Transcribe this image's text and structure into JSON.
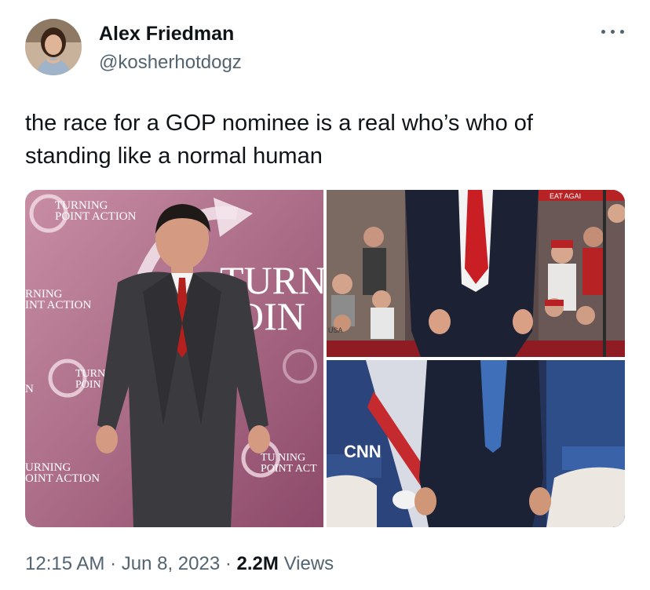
{
  "tweet": {
    "author_name": "Alex Friedman",
    "author_handle": "@kosherhotdogz",
    "text": "the race for a GOP nominee is a real who’s who of standing like a normal human",
    "time": "12:15 AM",
    "separator": "·",
    "date": "Jun 8, 2023",
    "views_count": "2.2M",
    "views_label": "Views"
  },
  "media": {
    "left_signage": [
      "TURNING",
      "POINT ACTION",
      "RNING",
      "INT ACTION",
      "TURN",
      "POIN",
      "N",
      "URNING",
      "OINT ACTION",
      "TU NING",
      "POINT ACT",
      "TURN",
      "OIN"
    ],
    "top_right_signage": [
      "EAT AGAI",
      "USA"
    ],
    "bottom_right_logo": "CNN"
  },
  "icons": {
    "more": "more-horizontal-icon"
  }
}
